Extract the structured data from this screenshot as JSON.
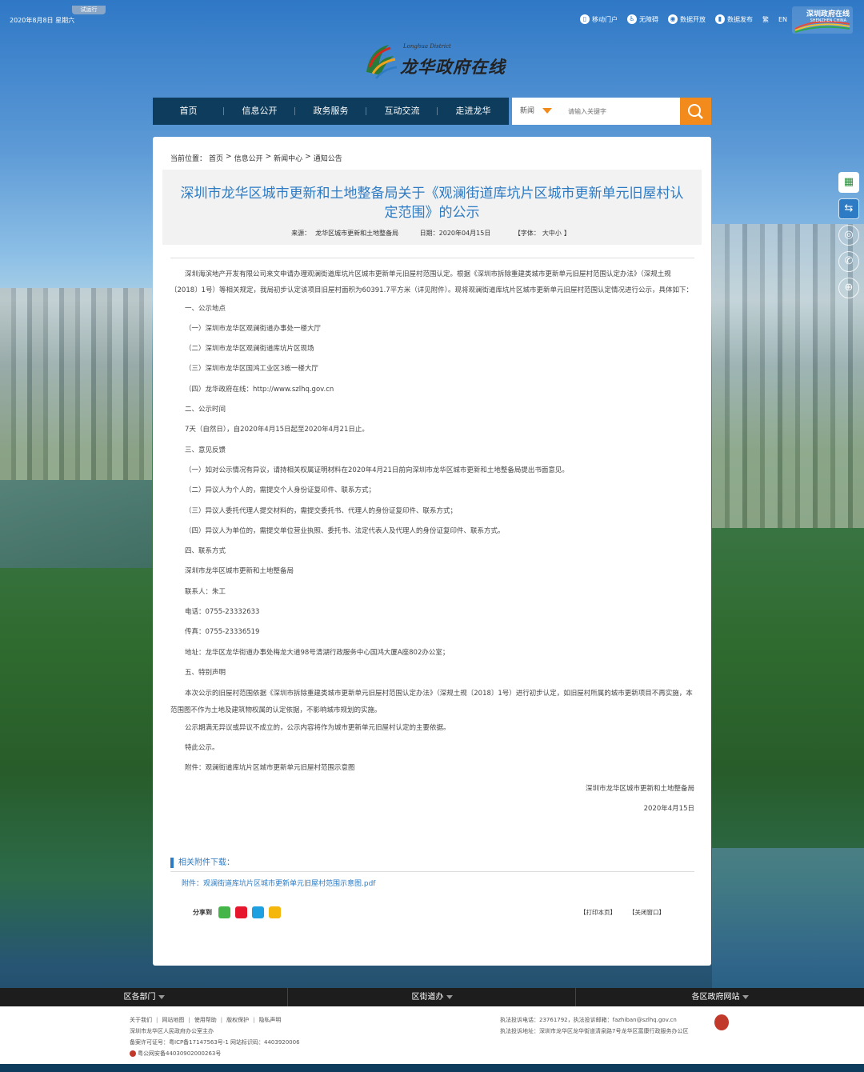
{
  "top": {
    "date": "2020年8月8日 星期六",
    "trial": "试运行",
    "links": [
      {
        "label": "移动门户",
        "icon": "mobile-icon"
      },
      {
        "label": "无障碍",
        "icon": "accessibility-icon"
      },
      {
        "label": "数据开放",
        "icon": "data-open-icon"
      },
      {
        "label": "数据发布",
        "icon": "data-publish-icon"
      },
      {
        "label": "繁",
        "icon": ""
      },
      {
        "label": "EN",
        "icon": ""
      }
    ],
    "shenzhen_logo_cn": "深圳政府在线",
    "shenzhen_logo_en": "SHENZHEN CHINA"
  },
  "logo": {
    "en": "Longhua District",
    "cn": "龙华政府在线"
  },
  "nav": {
    "items": [
      "首页",
      "信息公开",
      "政务服务",
      "互动交流",
      "走进龙华"
    ],
    "search_category": "新闻",
    "search_placeholder": "请输入关键字"
  },
  "breadcrumb": [
    "当前位置：",
    "首页",
    ">",
    "信息公开",
    ">",
    "新闻中心",
    ">",
    "通知公告"
  ],
  "article": {
    "title": "深圳市龙华区城市更新和土地整备局关于《观澜街道库坑片区城市更新单元旧屋村认定范围》的公示",
    "source_label": "来源：",
    "source": "龙华区城市更新和土地整备局",
    "date_label": "日期：",
    "date": "2020年04月15日",
    "font_label": "【字体：",
    "font_sizes": [
      "大",
      "中",
      "小"
    ],
    "font_end": "】",
    "intro": "深圳海滨地产开发有限公司来文申请办理观澜街道库坑片区城市更新单元旧屋村范围认定。根据《深圳市拆除重建类城市更新单元旧屋村范围认定办法》（深规土规〔2018〕1号）等相关规定，我局初步认定该项目旧屋村面积为60391.7平方米（详见附件）。现将观澜街道库坑片区城市更新单元旧屋村范围认定情况进行公示，具体如下：",
    "lines": [
      "一、公示地点",
      "（一）深圳市龙华区观澜街道办事处一楼大厅",
      "（二）深圳市龙华区观澜街道库坑片区现场",
      "（三）深圳市龙华区国鸿工业区3栋一楼大厅",
      "（四）龙华政府在线：http://www.szlhq.gov.cn",
      "二、公示时间",
      "7天（自然日），自2020年4月15日起至2020年4月21日止。",
      "三、意见反馈",
      "（一）如对公示情况有异议，请持相关权属证明材料在2020年4月21日前向深圳市龙华区城市更新和土地整备局提出书面意见。",
      "（二）异议人为个人的，需提交个人身份证复印件、联系方式；",
      "（三）异议人委托代理人提交材料的，需提交委托书、代理人的身份证复印件、联系方式；",
      "（四）异议人为单位的，需提交单位营业执照、委托书、法定代表人及代理人的身份证复印件、联系方式。",
      "四、联系方式",
      "深圳市龙华区城市更新和土地整备局",
      "联系人：朱工",
      "电话：0755-23332633",
      "传真：0755-23336519",
      "地址：龙华区龙华街道办事处梅龙大道98号清湖行政服务中心国鸿大厦A座802办公室；",
      "五、特别声明"
    ],
    "statement": "本次公示的旧屋村范围依据《深圳市拆除重建类城市更新单元旧屋村范围认定办法》（深规土规〔2018〕1号）进行初步认定，如旧屋村所属的城市更新项目不再实施，本范围图不作为土地及建筑物权属的认定依据，不影响城市规划的实施。",
    "tail_lines": [
      "公示期满无异议或异议不成立的，公示内容将作为城市更新单元旧屋村认定的主要依据。",
      "特此公示。",
      "附件：观澜街道库坑片区城市更新单元旧屋村范围示意图"
    ],
    "sign_org": "深圳市龙华区城市更新和土地整备局",
    "sign_date": "2020年4月15日"
  },
  "attachments": {
    "heading": "相关附件下载：",
    "link": "附件：观澜街道库坑片区城市更新单元旧屋村范围示意图.pdf"
  },
  "share": {
    "label": "分享到",
    "icons": [
      "wechat-icon",
      "weibo-icon",
      "qq-icon",
      "qzone-icon"
    ],
    "colors": [
      "#44b549",
      "#e6162d",
      "#1ea0e1",
      "#f5b70b"
    ]
  },
  "print_links": [
    "【打印本页】",
    "【关闭窗口】"
  ],
  "side_icons": [
    "qr-code-icon",
    "app-icon",
    "weibo-icon",
    "wechat-icon",
    "top-icon"
  ],
  "footer": {
    "bar": [
      "区各部门",
      "区街道办",
      "各区政府网站"
    ],
    "links": [
      "关于我们",
      "网站地图",
      "使用帮助",
      "版权保护",
      "隐私声明"
    ],
    "host": "深圳市龙华区人民政府办公室主办",
    "icp": "备案许可证号：粤ICP备17147563号-1 网站标识码：4403920006",
    "police": "粤公网安备44030902000263号",
    "complaint": "执法投诉电话：23761792，执法投诉邮箱：fazhiban@szlhq.gov.cn",
    "complaint_addr": "执法投诉地址：深圳市龙华区龙华街道清泉路7号龙华区富康行政服务办公区"
  },
  "colors": {
    "nav_bg": "#0e3c5c",
    "accent_orange": "#f28a1c",
    "title_blue": "#2c7bc4"
  }
}
